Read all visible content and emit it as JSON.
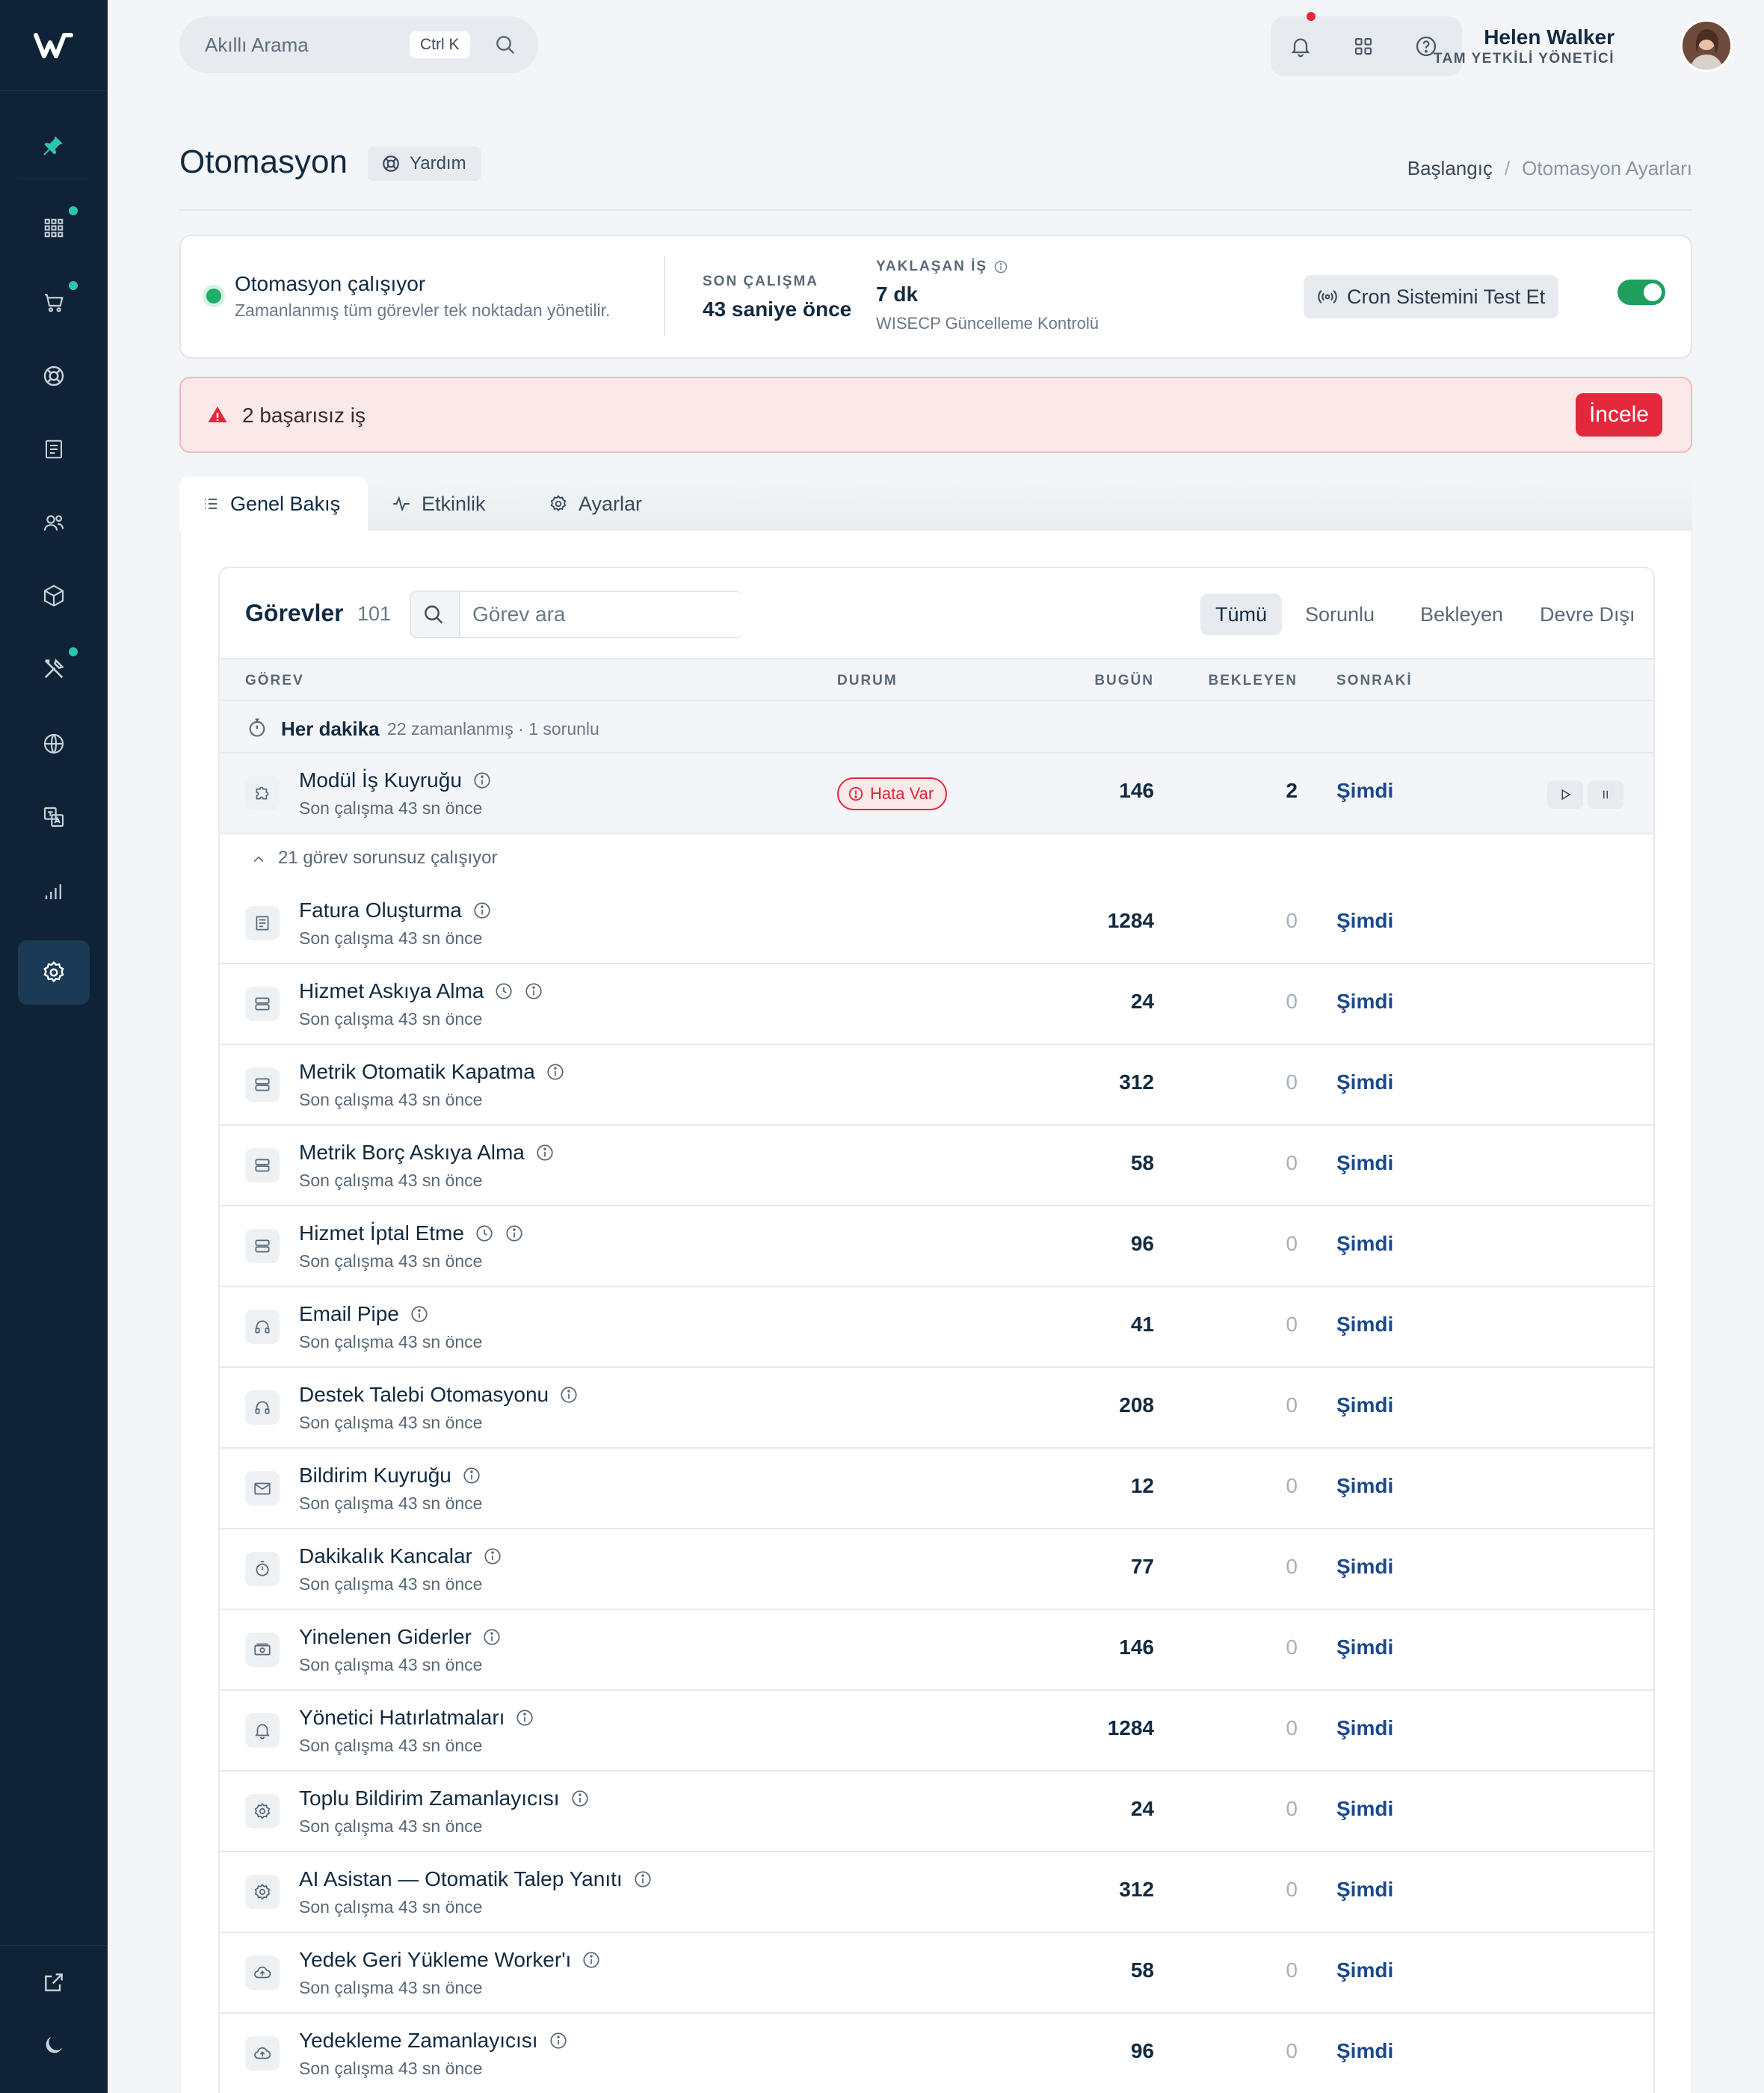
{
  "colors": {
    "sidebar": "#0f2236",
    "accent": "#2fc4b2",
    "danger": "#e3283b",
    "success": "#1f9f5e",
    "link": "#1b4a8a"
  },
  "header": {
    "search_placeholder": "Akıllı Arama",
    "search_shortcut": "Ctrl K",
    "user_name": "Helen Walker",
    "user_role": "TAM YETKİLİ YÖNETİCİ"
  },
  "page": {
    "title": "Otomasyon",
    "help_label": "Yardım",
    "breadcrumb": [
      "Başlangıç",
      "Otomasyon Ayarları"
    ]
  },
  "status": {
    "title": "Otomasyon çalışıyor",
    "subtitle": "Zamanlanmış tüm görevler tek noktadan yönetilir.",
    "last_run_label": "SON ÇALIŞMA",
    "last_run_value": "43 saniye önce",
    "next_label": "YAKLAŞAN İŞ",
    "next_value": "7 dk",
    "next_job": "WISECP Güncelleme Kontrolü",
    "cron_button": "Cron Sistemini Test Et",
    "enabled": true
  },
  "alert": {
    "text": "2 başarısız iş",
    "button": "İncele"
  },
  "tabs": [
    {
      "label": "Genel Bakış",
      "icon": "list-icon",
      "active": true
    },
    {
      "label": "Etkinlik",
      "icon": "activity-icon"
    },
    {
      "label": "Ayarlar",
      "icon": "gear-icon"
    }
  ],
  "tasks": {
    "title": "Görevler",
    "count": "101",
    "search_placeholder": "Görev ara",
    "filters": [
      "Tümü",
      "Sorunlu",
      "Bekleyen",
      "Devre Dışı"
    ],
    "columns": [
      "GÖREV",
      "DURUM",
      "BUGÜN",
      "BEKLEYEN",
      "SONRAKİ"
    ],
    "group": {
      "title": "Her dakika",
      "meta": "22 zamanlanmış · 1 sorunlu"
    },
    "error_row": {
      "name": "Modül İş Kuyruğu",
      "sub": "Son çalışma 43 sn önce",
      "status": "Hata Var",
      "today": "146",
      "pending": "2",
      "next": "Şimdi",
      "icon": "puzzle-icon"
    },
    "ok_header": "21 görev sorunsuz çalışıyor",
    "rows": [
      {
        "name": "Fatura Oluşturma",
        "sub": "Son çalışma 43 sn önce",
        "today": "1284",
        "pending": "0",
        "next": "Şimdi",
        "icon": "invoice-icon",
        "clock": false
      },
      {
        "name": "Hizmet Askıya Alma",
        "sub": "Son çalışma 43 sn önce",
        "today": "24",
        "pending": "0",
        "next": "Şimdi",
        "icon": "server-icon",
        "clock": true
      },
      {
        "name": "Metrik Otomatik Kapatma",
        "sub": "Son çalışma 43 sn önce",
        "today": "312",
        "pending": "0",
        "next": "Şimdi",
        "icon": "server-icon",
        "clock": false
      },
      {
        "name": "Metrik Borç Askıya Alma",
        "sub": "Son çalışma 43 sn önce",
        "today": "58",
        "pending": "0",
        "next": "Şimdi",
        "icon": "server-icon",
        "clock": false
      },
      {
        "name": "Hizmet İptal Etme",
        "sub": "Son çalışma 43 sn önce",
        "today": "96",
        "pending": "0",
        "next": "Şimdi",
        "icon": "server-icon",
        "clock": true
      },
      {
        "name": "Email Pipe",
        "sub": "Son çalışma 43 sn önce",
        "today": "41",
        "pending": "0",
        "next": "Şimdi",
        "icon": "headset-icon",
        "clock": false
      },
      {
        "name": "Destek Talebi Otomasyonu",
        "sub": "Son çalışma 43 sn önce",
        "today": "208",
        "pending": "0",
        "next": "Şimdi",
        "icon": "headset-icon",
        "clock": false
      },
      {
        "name": "Bildirim Kuyruğu",
        "sub": "Son çalışma 43 sn önce",
        "today": "12",
        "pending": "0",
        "next": "Şimdi",
        "icon": "mail-icon",
        "clock": false
      },
      {
        "name": "Dakikalık Kancalar",
        "sub": "Son çalışma 43 sn önce",
        "today": "77",
        "pending": "0",
        "next": "Şimdi",
        "icon": "stopwatch-icon",
        "clock": false
      },
      {
        "name": "Yinelenen Giderler",
        "sub": "Son çalışma 43 sn önce",
        "today": "146",
        "pending": "0",
        "next": "Şimdi",
        "icon": "cash-icon",
        "clock": false
      },
      {
        "name": "Yönetici Hatırlatmaları",
        "sub": "Son çalışma 43 sn önce",
        "today": "1284",
        "pending": "0",
        "next": "Şimdi",
        "icon": "bell-icon",
        "clock": false
      },
      {
        "name": "Toplu Bildirim Zamanlayıcısı",
        "sub": "Son çalışma 43 sn önce",
        "today": "24",
        "pending": "0",
        "next": "Şimdi",
        "icon": "gear-icon",
        "clock": false
      },
      {
        "name": "AI Asistan — Otomatik Talep Yanıtı",
        "sub": "Son çalışma 43 sn önce",
        "today": "312",
        "pending": "0",
        "next": "Şimdi",
        "icon": "gear-icon",
        "clock": false
      },
      {
        "name": "Yedek Geri Yükleme Worker'ı",
        "sub": "Son çalışma 43 sn önce",
        "today": "58",
        "pending": "0",
        "next": "Şimdi",
        "icon": "cloud-upload-icon",
        "clock": false
      },
      {
        "name": "Yedekleme Zamanlayıcısı",
        "sub": "Son çalışma 43 sn önce",
        "today": "96",
        "pending": "0",
        "next": "Şimdi",
        "icon": "cloud-upload-icon",
        "clock": false
      }
    ]
  }
}
